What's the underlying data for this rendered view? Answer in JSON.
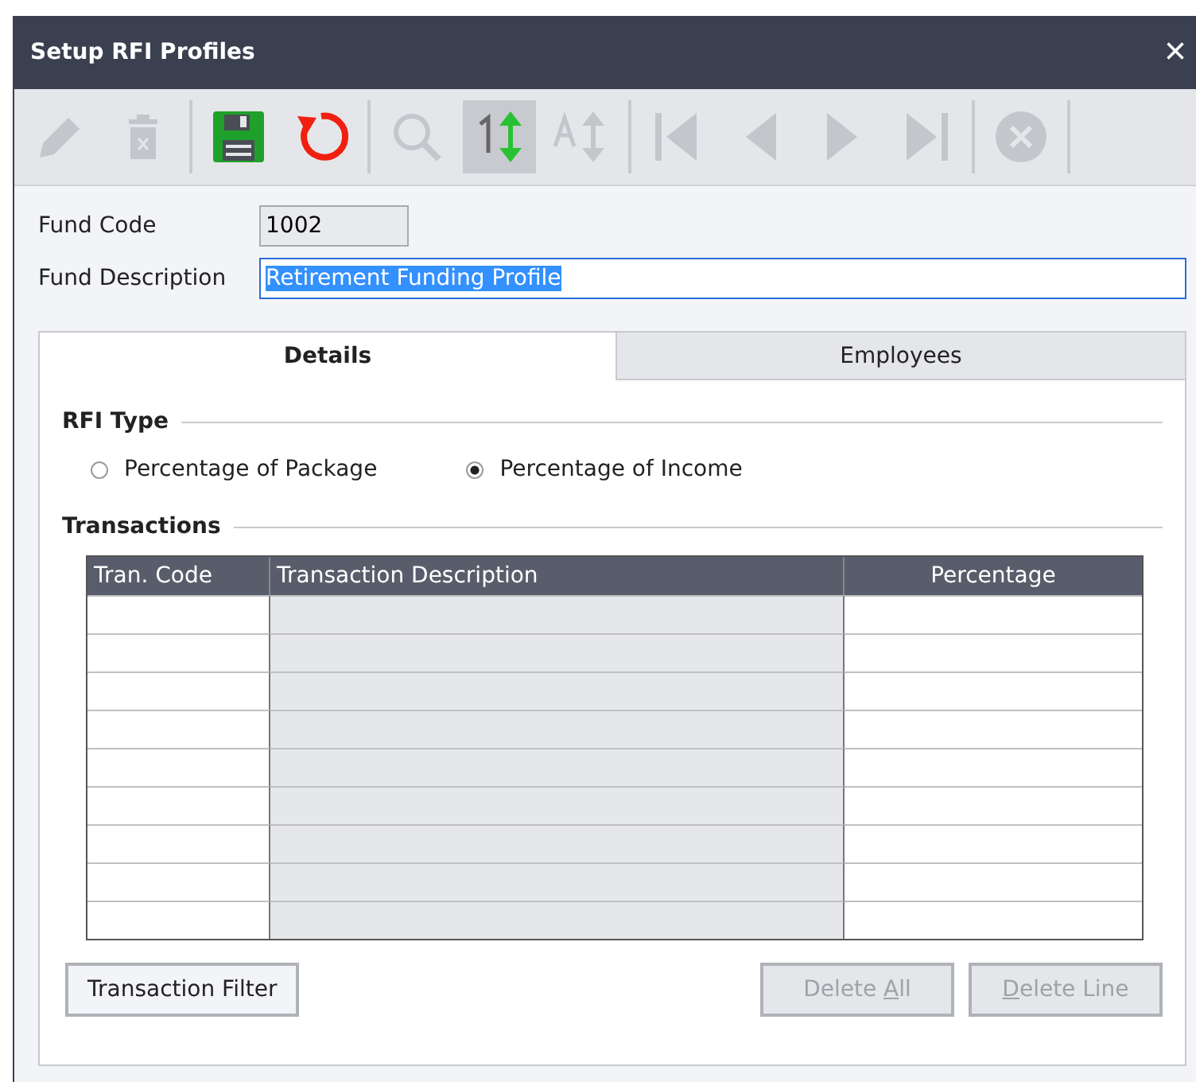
{
  "window": {
    "title": "Setup RFI Profiles",
    "close": "×"
  },
  "toolbar": [
    {
      "kind": "edit",
      "disabled": true,
      "selected": false
    },
    {
      "kind": "delete",
      "disabled": true,
      "selected": false
    },
    {
      "kind": "separator"
    },
    {
      "kind": "save",
      "disabled": false,
      "selected": false
    },
    {
      "kind": "undo",
      "disabled": false,
      "selected": false
    },
    {
      "kind": "separator"
    },
    {
      "kind": "search",
      "disabled": true,
      "selected": false
    },
    {
      "kind": "sort-number",
      "disabled": false,
      "selected": true
    },
    {
      "kind": "sort-alpha",
      "disabled": true,
      "selected": false
    },
    {
      "kind": "separator"
    },
    {
      "kind": "first",
      "disabled": true,
      "selected": false
    },
    {
      "kind": "previous",
      "disabled": true,
      "selected": false
    },
    {
      "kind": "next",
      "disabled": true,
      "selected": false
    },
    {
      "kind": "last",
      "disabled": true,
      "selected": false
    },
    {
      "kind": "separator"
    },
    {
      "kind": "cancel",
      "disabled": true,
      "selected": false
    },
    {
      "kind": "separator"
    }
  ],
  "fields": [
    {
      "label": "Fund Code",
      "value": "1002",
      "kind": "short",
      "highlighted": false
    },
    {
      "label": "Fund Description",
      "value": "Retirement Funding Profile",
      "kind": "wide",
      "highlighted": true
    }
  ],
  "tabs": [
    {
      "label": "Details",
      "selected": true
    },
    {
      "label": "Employees",
      "selected": false
    }
  ],
  "rfi_type": {
    "title": "RFI Type",
    "options": [
      {
        "label": "Percentage of Package",
        "selected": false
      },
      {
        "label": "Percentage of Income",
        "selected": true
      }
    ]
  },
  "transactions": {
    "title": "Transactions",
    "columns": [
      "Tran. Code",
      "Transaction Description",
      "Percentage"
    ]
  },
  "buttons": [
    {
      "label": "Transaction Filter",
      "disabled": false
    },
    {
      "label": "Delete ",
      "access_key": "A",
      "label_after": "ll",
      "disabled": true
    },
    {
      "access_key": "D",
      "label_after": "elete Line",
      "disabled": true
    }
  ]
}
